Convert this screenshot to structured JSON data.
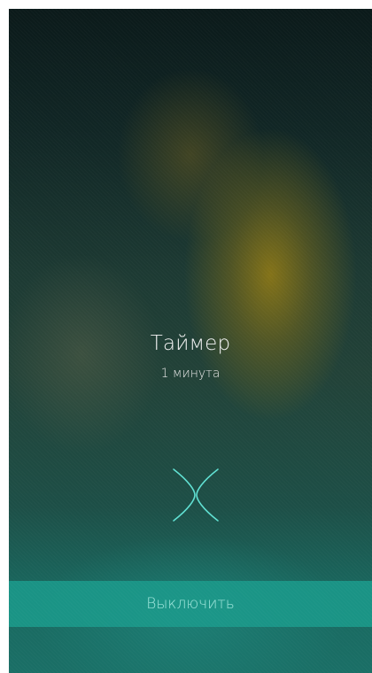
{
  "timer": {
    "title": "Таймер",
    "duration": "1 минута"
  },
  "dismiss": {
    "icon": "x-swipe-icon"
  },
  "action": {
    "stop_label": "Выключить"
  },
  "colors": {
    "accent": "#1b9b8c",
    "icon": "#5fe0d2"
  }
}
